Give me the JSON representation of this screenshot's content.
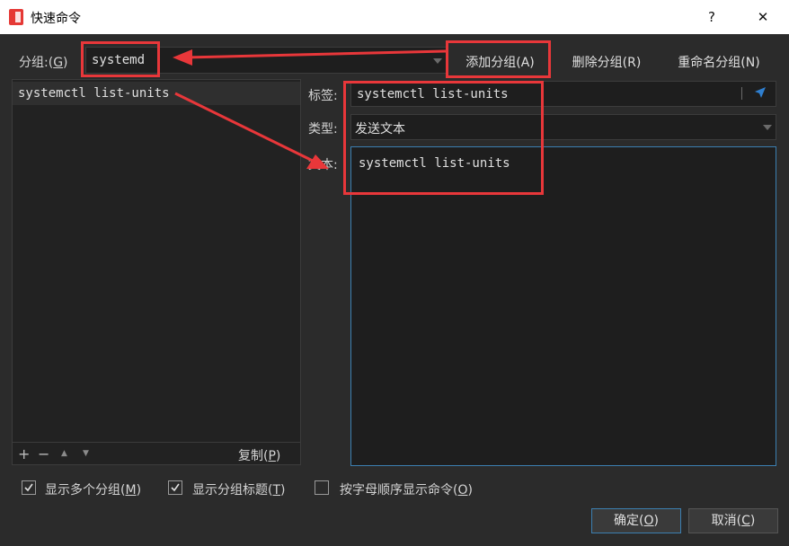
{
  "window": {
    "title": "快速命令",
    "help": "?",
    "close": "✕"
  },
  "group_row": {
    "label_prefix": "分组:(",
    "label_key": "G",
    "label_suffix": ")",
    "selected": "systemd",
    "add_prefix": "添加分组(",
    "add_key": "A",
    "add_suffix": ")",
    "delete_prefix": "删除分组(",
    "delete_key": "R",
    "delete_suffix": ")",
    "rename_prefix": "重命名分组(",
    "rename_key": "N",
    "rename_suffix": ")"
  },
  "command_list": {
    "items": [
      "systemctl list-units"
    ],
    "add": "+",
    "remove": "−",
    "up": "▲",
    "down": "▼",
    "copy_prefix": "复制(",
    "copy_key": "P",
    "copy_suffix": ")"
  },
  "editor": {
    "tag_label": "标签:",
    "tag_value": "systemctl list-units",
    "type_label": "类型:",
    "type_value": "发送文本",
    "text_label": "文本:",
    "text_value": "systemctl list-units"
  },
  "options": [
    {
      "prefix": "显示多个分组(",
      "key": "M",
      "suffix": ")",
      "checked": true
    },
    {
      "prefix": "显示分组标题(",
      "key": "T",
      "suffix": ")",
      "checked": true
    },
    {
      "prefix": "按字母顺序显示命令(",
      "key": "O",
      "suffix": ")",
      "checked": false
    }
  ],
  "footer": {
    "ok_prefix": "确定(",
    "ok_key": "O",
    "ok_suffix": ")",
    "cancel_prefix": "取消(",
    "cancel_key": "C",
    "cancel_suffix": ")"
  },
  "colors": {
    "annotation": "#e8373a",
    "focus": "#3c7fb1",
    "background": "#2b2b2b"
  }
}
